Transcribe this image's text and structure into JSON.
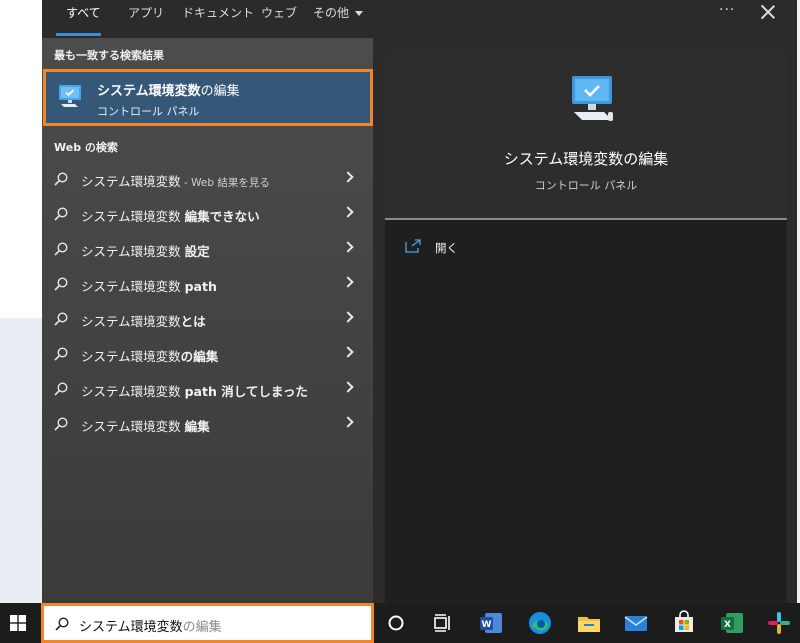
{
  "tabs": [
    "すべて",
    "アプリ",
    "ドキュメント",
    "ウェブ",
    "その他"
  ],
  "header": {
    "more": "···"
  },
  "left": {
    "best_match_header": "最も一致する検索結果",
    "best_match": {
      "title_bold": "システム環境変数",
      "title_light": "の編集",
      "subtitle": "コントロール パネル"
    },
    "web_header": "Web の検索",
    "web_results": [
      {
        "normal": "システム環境変数",
        "bold": "",
        "sub": " - Web 結果を見る"
      },
      {
        "normal": "システム環境変数 ",
        "bold": "編集できない",
        "sub": ""
      },
      {
        "normal": "システム環境変数 ",
        "bold": "設定",
        "sub": ""
      },
      {
        "normal": "システム環境変数 ",
        "bold": "path",
        "sub": ""
      },
      {
        "normal": "システム環境変数",
        "bold": "とは",
        "sub": ""
      },
      {
        "normal": "システム環境変数",
        "bold": "の編集",
        "sub": ""
      },
      {
        "normal": "システム環境変数 ",
        "bold": "path 消してしまった",
        "sub": ""
      },
      {
        "normal": "システム環境変数 ",
        "bold": "編集",
        "sub": ""
      }
    ]
  },
  "right": {
    "title": "システム環境変数の編集",
    "subtitle": "コントロール パネル",
    "action_open": "開く"
  },
  "taskbar": {
    "search_value": "システム環境変数",
    "search_hint": "の編集",
    "apps": [
      "cortana-icon",
      "task-view-icon",
      "word-icon",
      "edge-icon",
      "file-explorer-icon",
      "mail-icon",
      "store-icon",
      "excel-icon",
      "slack-icon"
    ]
  },
  "colors": {
    "highlight": "#f0852b",
    "selected": "#355879",
    "accent": "#3a8fd8"
  }
}
